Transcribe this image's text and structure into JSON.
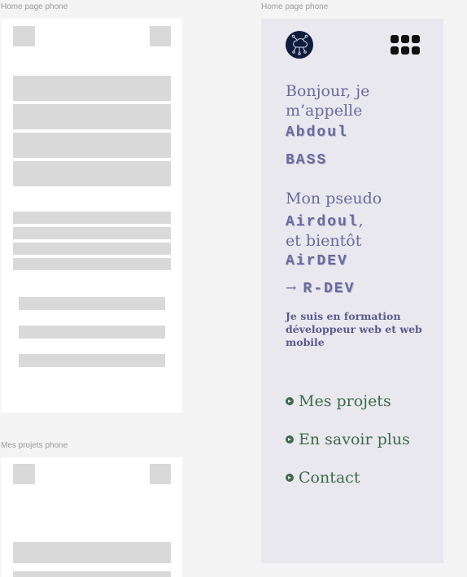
{
  "frames": {
    "left_top_label": "Home page phone",
    "left_bottom_label": "Mes projets phone",
    "right_label": "Home page phone"
  },
  "home": {
    "logo_icon": "cloud-circuit-logo-icon",
    "menu_icon": "grid-menu-icon",
    "greeting_line1": "Bonjour, je",
    "greeting_line2": "m’appelle",
    "first_name": "Abdoul",
    "last_name": "BASS",
    "pseudo_intro": "Mon pseudo",
    "pseudo_name": "Airdoul",
    "comma": ",",
    "soon": "et bientôt",
    "dev_name": "AirDEV",
    "arrow": "→",
    "rdev": "R-DEV",
    "description": "Je suis en formation développeur web et web mobile",
    "nav": [
      {
        "label": "Mes projets",
        "icon": "chevron-right-circle-icon"
      },
      {
        "label": "En savoir plus",
        "icon": "chevron-right-circle-icon"
      },
      {
        "label": "Contact",
        "icon": "chevron-right-circle-icon"
      }
    ]
  },
  "colors": {
    "phone_bg": "#e9e8ef",
    "text_purple": "#6b6a9c",
    "nav_green": "#3f6b4a",
    "wireframe_gray": "#d9d9d9"
  }
}
